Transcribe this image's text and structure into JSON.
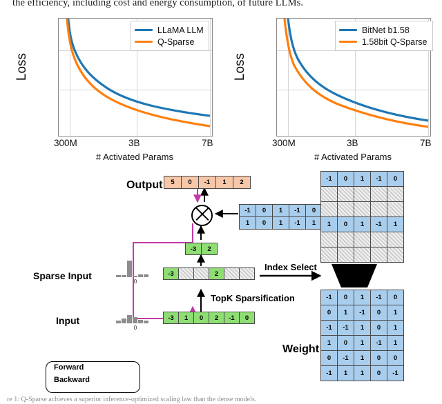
{
  "page": {
    "top_paragraph": "the efficiency, including cost and energy consumption, of future LLMs.",
    "caption": "re 1: Q-Sparse achieves a superior inference-optimized scaling law than the dense models."
  },
  "chart_data": [
    {
      "type": "line",
      "title": "",
      "xlabel": "# Activated Params",
      "ylabel": "Loss",
      "xticks": [
        "300M",
        "3B",
        "7B"
      ],
      "grid": true,
      "legend_position": "top-right",
      "series": [
        {
          "name": "LLaMA LLM",
          "color": "#1f77b4"
        },
        {
          "name": "Q-Sparse",
          "color": "#ff7f0e"
        }
      ]
    },
    {
      "type": "line",
      "title": "",
      "xlabel": "# Activated Params",
      "ylabel": "Loss",
      "xticks": [
        "300M",
        "3B",
        "7B"
      ],
      "grid": true,
      "legend_position": "top-right",
      "series": [
        {
          "name": "BitNet b1.58",
          "color": "#1f77b4"
        },
        {
          "name": "1.58bit Q-Sparse",
          "color": "#ff7f0e"
        }
      ]
    }
  ],
  "diagram": {
    "labels": {
      "output": "Output",
      "sparse_input": "Sparse Input",
      "input": "Input",
      "weight": "Weight",
      "index_select": "Index Select",
      "topk": "TopK Sparsification",
      "zero_left": "0",
      "zero_left2": "0"
    },
    "output_row": [
      "5",
      "0",
      "-1",
      "1",
      "2"
    ],
    "selected_weight_rows": [
      [
        "-1",
        "0",
        "1",
        "-1",
        "0"
      ],
      [
        "1",
        "0",
        "1",
        "-1",
        "1"
      ]
    ],
    "gathered_matrix": {
      "rows": 6,
      "cols": 5,
      "values": [
        [
          "-1",
          "0",
          "1",
          "-1",
          "0"
        ],
        [
          "",
          "",
          "",
          "",
          ""
        ],
        [
          "",
          "",
          "",
          "",
          ""
        ],
        [
          "1",
          "0",
          "1",
          "-1",
          "1"
        ],
        [
          "",
          "",
          "",
          "",
          ""
        ],
        [
          "",
          "",
          "",
          "",
          ""
        ]
      ],
      "active_rows": [
        0,
        3
      ]
    },
    "weight_matrix": [
      [
        "-1",
        "0",
        "1",
        "-1",
        "0"
      ],
      [
        "0",
        "1",
        "-1",
        "0",
        "1"
      ],
      [
        "-1",
        "-1",
        "1",
        "0",
        "1"
      ],
      [
        "1",
        "0",
        "1",
        "-1",
        "1"
      ],
      [
        "0",
        "-1",
        "1",
        "0",
        "0"
      ],
      [
        "-1",
        "1",
        "1",
        "0",
        "-1"
      ]
    ],
    "topk_values": [
      "-3",
      "2"
    ],
    "sparse_input_row": [
      "-3",
      "0",
      "0",
      "2",
      "0",
      "0"
    ],
    "sparse_input_mask": [
      1,
      0,
      0,
      1,
      0,
      0
    ],
    "input_row": [
      "-3",
      "1",
      "0",
      "2",
      "-1",
      "0"
    ],
    "legend": {
      "forward": "Forward",
      "backward": "Backward",
      "forward_color": "#000000",
      "backward_color": "#c13ba5"
    },
    "colors": {
      "output_cell": "#f6c7a8",
      "input_cell": "#8ede74",
      "weight_cell": "#a9cdec"
    }
  }
}
